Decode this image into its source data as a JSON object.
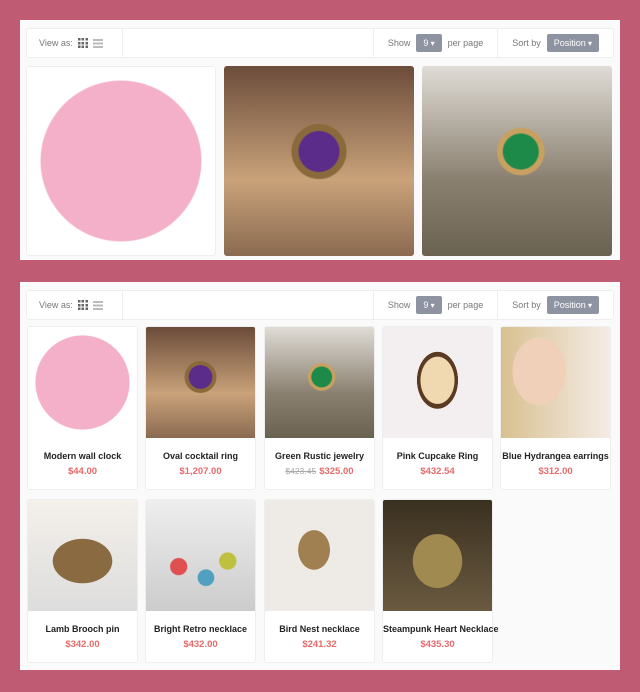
{
  "toolbar": {
    "view_as": "View as:",
    "show": "Show",
    "per_page_value": "9",
    "per_page": "per page",
    "sort_by": "Sort by",
    "sort_value": "Position"
  },
  "colors": {
    "background": "#bf5c73",
    "price": "#e86a6a",
    "select": "#8e93a1"
  },
  "products": [
    {
      "name": "Modern wall clock",
      "price": "$44.00",
      "img": "radial-gradient(circle,#f4b0c8 0 60%,#fff 61%)"
    },
    {
      "name": "Oval cocktail ring",
      "price": "$1,207.00",
      "img": "radial-gradient(circle at 50% 45%,#5b2c8a 0 14%,#8a6a3a 15% 19%,transparent 20%),linear-gradient(#6b4c3a,#c9a27a 60%,#8a6a50)"
    },
    {
      "name": "Green Rustic jewelry",
      "old_price": "$423.45",
      "price": "$325.00",
      "img": "radial-gradient(circle at 52% 45%,#1d8a4a 0 12%,#c8a060 13% 16%,transparent 17%),linear-gradient(#e0dcd6,#8a8070 60%,#6a6250)"
    },
    {
      "name": "Pink Cupcake Ring",
      "price": "$432.54",
      "img": "radial-gradient(ellipse 22% 30% at 50% 48%,#f0d8b0 0 70%,#5a3a20 72% 85%,transparent 86%),#f3eef0"
    },
    {
      "name": "Blue Hydrangea earrings",
      "price": "$312.00",
      "img": "radial-gradient(ellipse 40% 50% at 35% 40%,#f0d0b8 0 60%,transparent 62%),linear-gradient(90deg,#d8c090,#f4ece6)"
    },
    {
      "name": "Lamb Brooch pin",
      "price": "$342.00",
      "img": "radial-gradient(ellipse 30% 22% at 50% 55%,#8a6a40 0 90%,transparent 92%),linear-gradient(#f4f0ea,#ddd)"
    },
    {
      "name": "Bright Retro necklace",
      "price": "$432.00",
      "img": "radial-gradient(circle at 30% 60%,#e05050 0 8%,transparent 9%),radial-gradient(circle at 55% 70%,#50a0c0 0 8%,transparent 9%),radial-gradient(circle at 75% 55%,#c0c040 0 8%,transparent 9%),linear-gradient(#eee,#ccc)"
    },
    {
      "name": "Bird Nest necklace",
      "price": "$241.32",
      "img": "radial-gradient(ellipse 18% 22% at 45% 45%,#a08050 0 80%,transparent 82%),#eeeae6"
    },
    {
      "name": "Steampunk Heart Necklace",
      "price": "$435.30",
      "img": "radial-gradient(ellipse 28% 30% at 50% 55%,#a08a50 0 80%,transparent 82%),linear-gradient(#3a3020,#6a5a40)"
    }
  ]
}
